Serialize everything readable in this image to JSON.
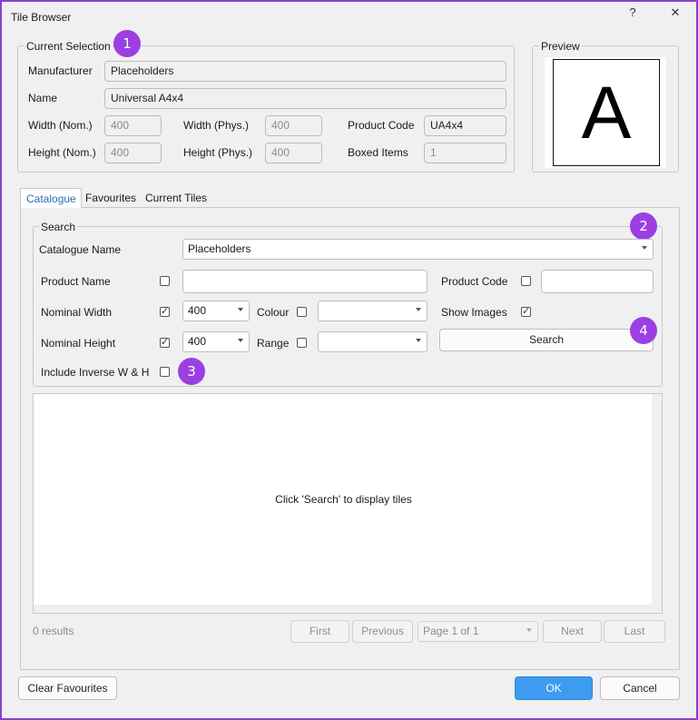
{
  "window": {
    "title": "Tile Browser",
    "help_glyph": "?",
    "close_glyph": "✕"
  },
  "current_selection": {
    "legend": "Current Selection",
    "manufacturer_label": "Manufacturer",
    "manufacturer": "Placeholders",
    "name_label": "Name",
    "name": "Universal A4x4",
    "width_nom_label": "Width (Nom.)",
    "width_nom": "400",
    "width_phys_label": "Width (Phys.)",
    "width_phys": "400",
    "product_code_label": "Product Code",
    "product_code": "UA4x4",
    "height_nom_label": "Height (Nom.)",
    "height_nom": "400",
    "height_phys_label": "Height (Phys.)",
    "height_phys": "400",
    "boxed_items_label": "Boxed Items",
    "boxed_items": "1"
  },
  "preview": {
    "legend": "Preview",
    "letter": "A"
  },
  "tabs": [
    {
      "label": "Catalogue",
      "active": true
    },
    {
      "label": "Favourites",
      "active": false
    },
    {
      "label": "Current Tiles",
      "active": false
    }
  ],
  "search": {
    "legend": "Search",
    "catalogue_name_label": "Catalogue Name",
    "catalogue_name": "Placeholders",
    "product_name_label": "Product Name",
    "product_name": "",
    "product_name_checked": false,
    "product_code_label": "Product Code",
    "product_code": "",
    "product_code_checked": false,
    "nominal_width_label": "Nominal Width",
    "nominal_width_checked": true,
    "nominal_width": "400",
    "colour_label": "Colour",
    "colour_checked": false,
    "colour": "",
    "show_images_label": "Show Images",
    "show_images_checked": true,
    "nominal_height_label": "Nominal Height",
    "nominal_height_checked": true,
    "nominal_height": "400",
    "range_label": "Range",
    "range_checked": false,
    "range": "",
    "search_button": "Search",
    "include_inverse_label": "Include Inverse W & H",
    "include_inverse_checked": false
  },
  "results": {
    "placeholder": "Click 'Search' to display tiles",
    "count_text": "0 results",
    "first": "First",
    "previous": "Previous",
    "page": "Page 1 of 1",
    "next": "Next",
    "last": "Last"
  },
  "footer": {
    "clear_favourites": "Clear Favourites",
    "ok": "OK",
    "cancel": "Cancel"
  },
  "badges": [
    "1",
    "2",
    "3",
    "4"
  ],
  "colors": {
    "badge": "#9b3fe3",
    "ok_button": "#3d9bf0",
    "tab_active": "#2a6fb3",
    "frame": "#8a3fd1"
  }
}
